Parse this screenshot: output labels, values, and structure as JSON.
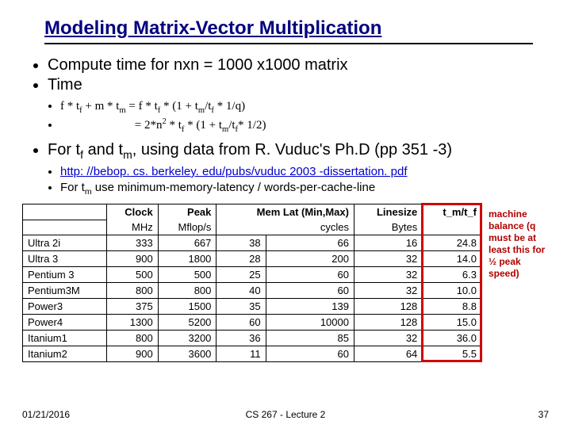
{
  "title": "Modeling Matrix-Vector Multiplication",
  "bullets": {
    "b1a": "Compute time for nxn = 1000 x1000 matrix",
    "b1b": "Time",
    "eq1_pre": "f * t",
    "eq1_mid1": " + m * t",
    "eq1_mid2": " = f * t",
    "eq1_mid3": " * (1 + t",
    "eq1_mid4": "/t",
    "eq1_end": " * 1/q)",
    "eq2_pre": "= 2*n",
    "eq2_mid1": " * t",
    "eq2_mid2": " * (1 +  t",
    "eq2_mid3": "/t",
    "eq2_end": "* 1/2)",
    "b1c_pre": "For t",
    "b1c_mid": " and t",
    "b1c_end": ", using data from R. Vuduc's Ph.D (pp 351 -3)",
    "link": "http: //bebop. cs. berkeley. edu/pubs/vuduc 2003 -dissertation. pdf",
    "b3b_pre": "For t",
    "b3b_end": " use minimum-memory-latency / words-per-cache-line"
  },
  "sub": {
    "f": "f",
    "m": "m"
  },
  "sup": {
    "two": "2"
  },
  "side_note": "machine balance (q must be at least this for ½ peak speed)",
  "chart_data": {
    "type": "table",
    "headers_top": [
      "",
      "Clock",
      "Peak",
      "Mem Lat (Min,Max)",
      "Linesize",
      "t_m/t_f"
    ],
    "headers_bot": [
      "",
      "MHz",
      "Mflop/s",
      "cycles",
      "Bytes",
      ""
    ],
    "rows": [
      {
        "name": "Ultra 2i",
        "clock": 333,
        "peak": 667,
        "lat_min": 38,
        "lat_max": 66,
        "linesize": 16,
        "ratio": 24.8
      },
      {
        "name": "Ultra 3",
        "clock": 900,
        "peak": 1800,
        "lat_min": 28,
        "lat_max": 200,
        "linesize": 32,
        "ratio": 14.0
      },
      {
        "name": "Pentium 3",
        "clock": 500,
        "peak": 500,
        "lat_min": 25,
        "lat_max": 60,
        "linesize": 32,
        "ratio": 6.3
      },
      {
        "name": "Pentium3M",
        "clock": 800,
        "peak": 800,
        "lat_min": 40,
        "lat_max": 60,
        "linesize": 32,
        "ratio": 10.0
      },
      {
        "name": "Power3",
        "clock": 375,
        "peak": 1500,
        "lat_min": 35,
        "lat_max": 139,
        "linesize": 128,
        "ratio": 8.8
      },
      {
        "name": "Power4",
        "clock": 1300,
        "peak": 5200,
        "lat_min": 60,
        "lat_max": 10000,
        "linesize": 128,
        "ratio": 15.0
      },
      {
        "name": "Itanium1",
        "clock": 800,
        "peak": 3200,
        "lat_min": 36,
        "lat_max": 85,
        "linesize": 32,
        "ratio": 36.0
      },
      {
        "name": "Itanium2",
        "clock": 900,
        "peak": 3600,
        "lat_min": 11,
        "lat_max": 60,
        "linesize": 64,
        "ratio": 5.5
      }
    ]
  },
  "footer": {
    "date": "01/21/2016",
    "center": "CS 267 - Lecture 2",
    "page": "37"
  }
}
